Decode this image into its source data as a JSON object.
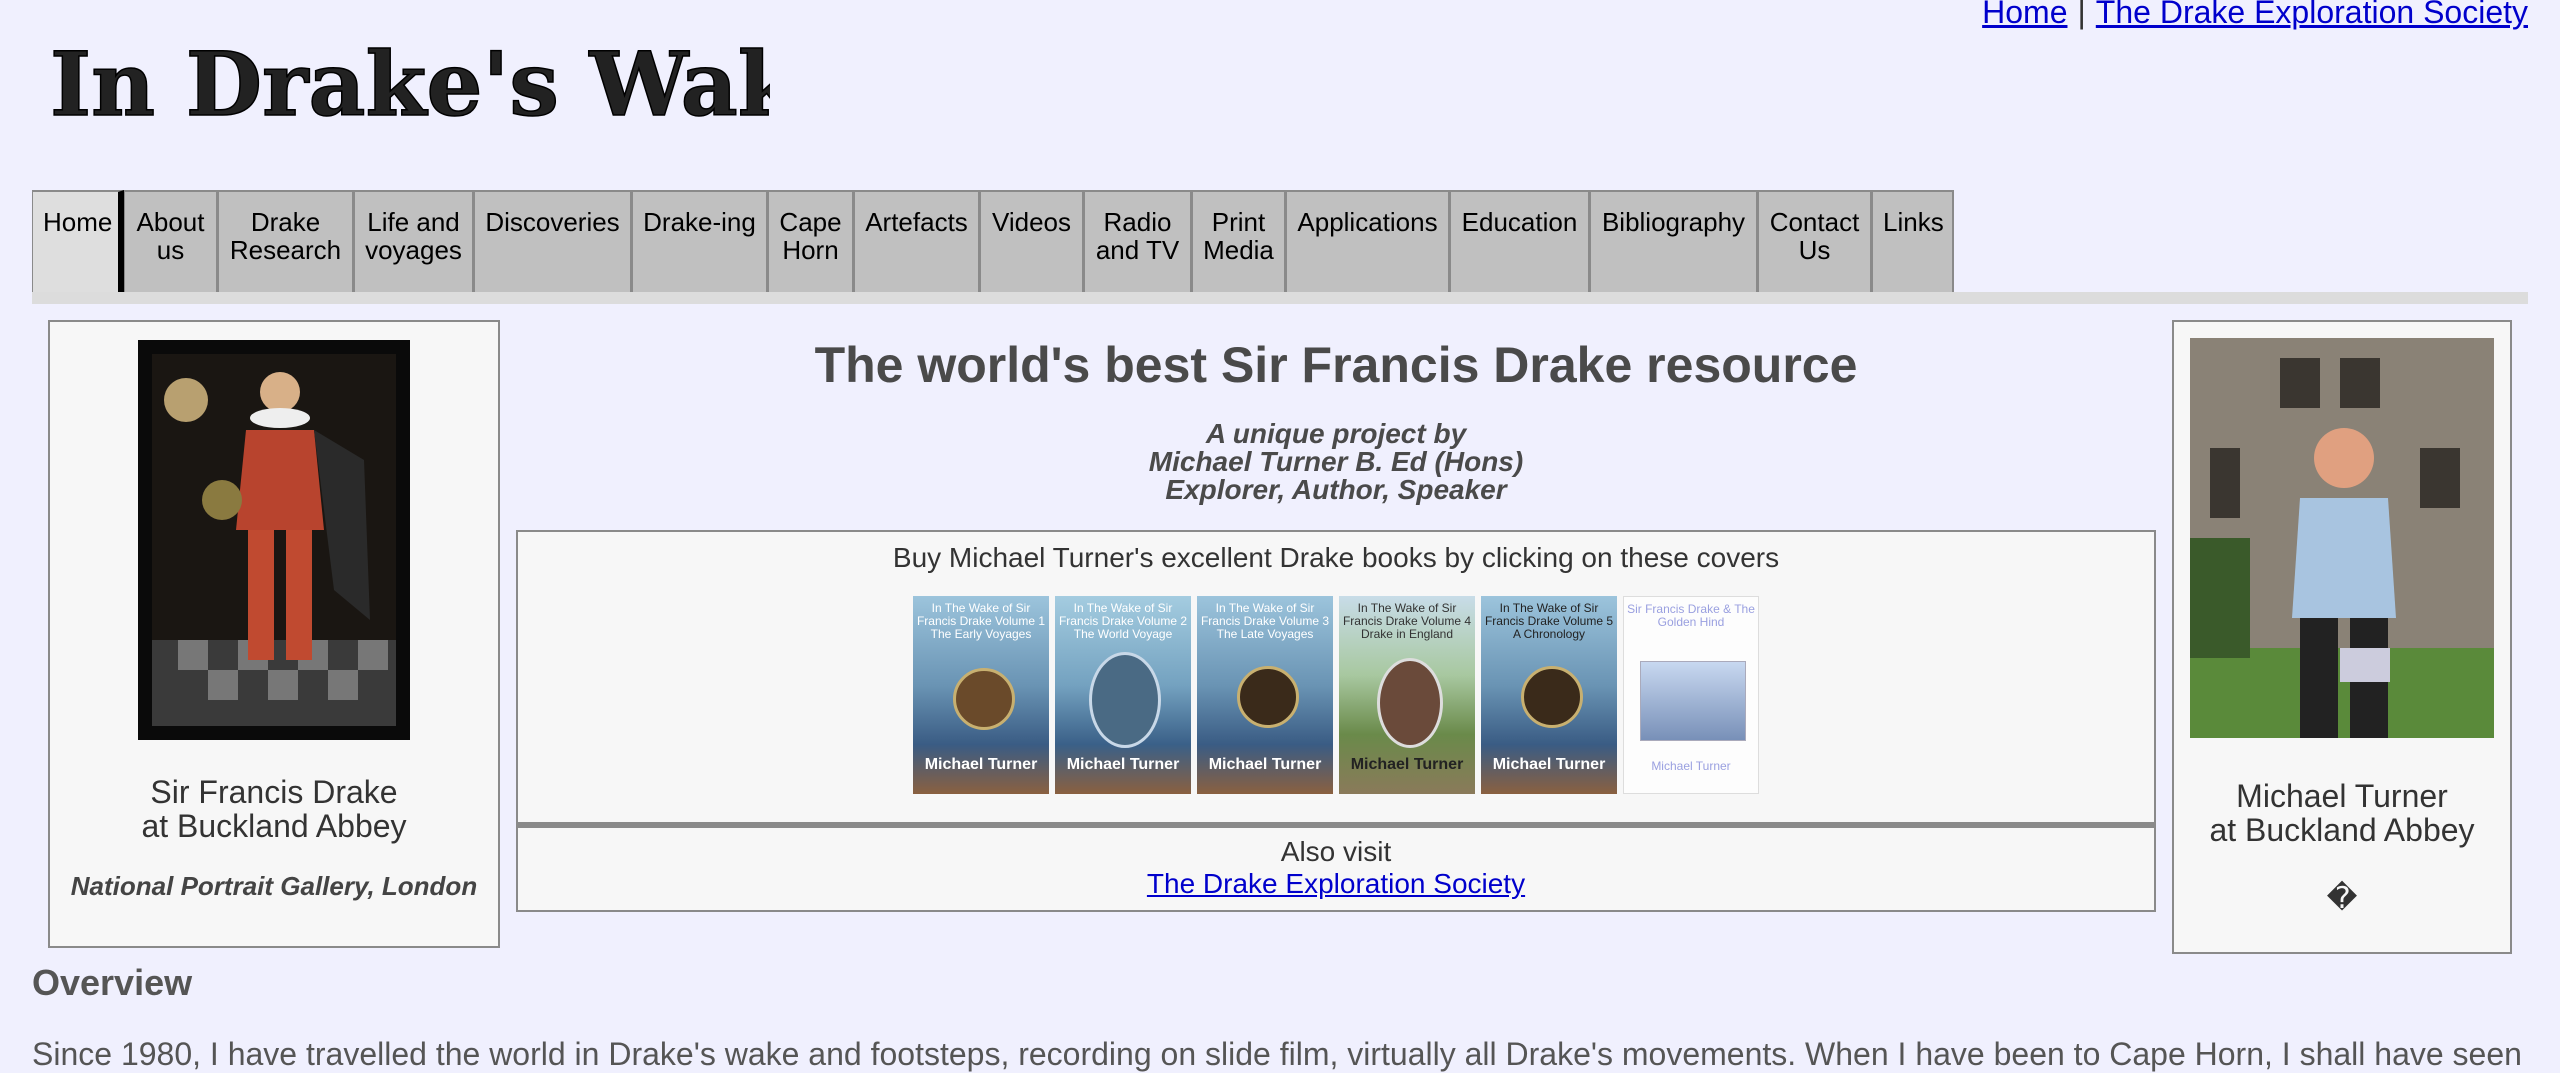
{
  "top_links": {
    "home": "Home",
    "separator": "|",
    "society": "The Drake Exploration Society"
  },
  "logo_text": "In Drake's Wake",
  "nav": [
    {
      "label": "Home",
      "active": true
    },
    {
      "label": "About us"
    },
    {
      "label": "Drake Research"
    },
    {
      "label": "Life and voyages"
    },
    {
      "label": "Discoveries"
    },
    {
      "label": "Drake-ing"
    },
    {
      "label": "Cape Horn"
    },
    {
      "label": "Artefacts"
    },
    {
      "label": "Videos"
    },
    {
      "label": "Radio and TV"
    },
    {
      "label": "Print Media"
    },
    {
      "label": "Applications"
    },
    {
      "label": "Education"
    },
    {
      "label": "Bibliography"
    },
    {
      "label": "Contact Us"
    },
    {
      "label": "Links"
    }
  ],
  "left_card": {
    "caption_line1": "Sir Francis Drake",
    "caption_line2": "at Buckland Abbey",
    "credit": "National Portrait Gallery, London"
  },
  "center": {
    "headline": "The world's best Sir Francis Drake resource",
    "byline": [
      "A unique project by",
      "Michael Turner B. Ed (Hons)",
      "Explorer, Author, Speaker"
    ],
    "books_prompt": "Buy Michael Turner's excellent Drake books by clicking on these covers",
    "covers": [
      {
        "title": "In The Wake of Sir Francis Drake Volume 1 The Early Voyages",
        "author": "Michael Turner"
      },
      {
        "title": "In The Wake of Sir Francis Drake Volume 2 The World Voyage",
        "author": "Michael Turner"
      },
      {
        "title": "In The Wake of Sir Francis Drake Volume 3 The Late Voyages",
        "author": "Michael Turner"
      },
      {
        "title": "In The Wake of Sir Francis Drake Volume 4 Drake in England",
        "author": "Michael Turner"
      },
      {
        "title": "In The Wake of Sir Francis Drake Volume 5 A Chronology",
        "author": "Michael Turner"
      },
      {
        "title": "Sir Francis Drake & The Golden Hind",
        "author": "Michael Turner"
      }
    ],
    "also_visit": "Also visit",
    "society_link": "The Drake Exploration Society"
  },
  "right_card": {
    "caption_line1": "Michael Turner",
    "caption_line2": "at Buckland Abbey",
    "glyph": "�"
  },
  "overview": {
    "title": "Overview",
    "text": "Since 1980, I have travelled the world in Drake's wake and footsteps, recording on slide film, virtually all Drake's movements. When I have been to Cape Horn, I shall have seen"
  },
  "colors": {
    "background": "#f0f0fe",
    "tab": "#c0c0c0",
    "link": "#0000cc"
  }
}
